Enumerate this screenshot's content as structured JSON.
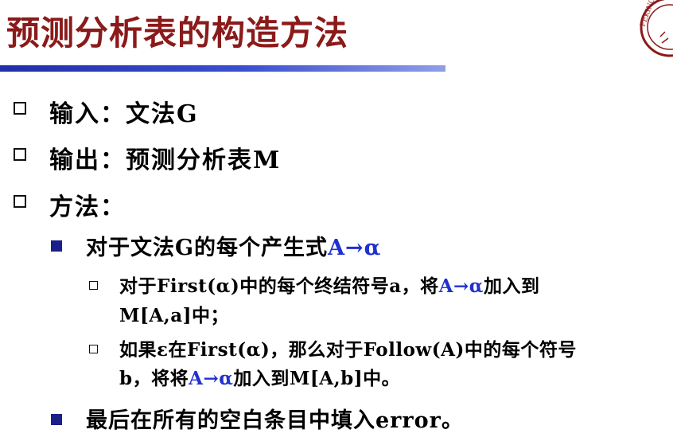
{
  "title": "预测分析表的构造方法",
  "level1": [
    {
      "text": "输入：文法G"
    },
    {
      "text": "输出：预测分析表M"
    },
    {
      "text": "方法："
    }
  ],
  "level2": [
    {
      "pre": "对于文法G的每个产生式",
      "hl": "A→α",
      "post": ""
    },
    {
      "pre": "最后在所有的空白条目中填入error。",
      "hl": "",
      "post": ""
    }
  ],
  "level3": [
    {
      "line1_pre": "对于First(α)中的每个终结符号a，将",
      "line1_hl": "A→α",
      "line1_post": "加入到",
      "line2": "M[A,a]中；"
    },
    {
      "line1": "如果ε在First(α)，那么对于Follow(A)中的每个符号",
      "line2_pre": "b，将将",
      "line2_hl": "A→α",
      "line2_post": "加入到M[A,b]中。"
    }
  ],
  "logo": {
    "text": "PEKING"
  },
  "colors": {
    "title": "#8b1a1a",
    "rule": "#1f2fa8",
    "highlight": "#2030d0",
    "bullet_fill": "#1b1f8a"
  }
}
